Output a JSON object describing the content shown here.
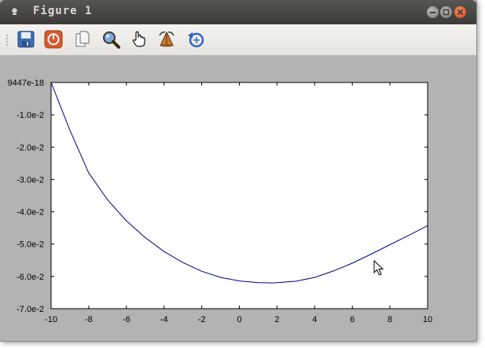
{
  "window": {
    "title": "Figure 1"
  },
  "toolbar": {
    "tools": [
      {
        "name": "save-icon"
      },
      {
        "name": "power-icon"
      },
      {
        "name": "copy-icon"
      },
      {
        "name": "zoom-icon"
      },
      {
        "name": "pan-hand-icon"
      },
      {
        "name": "rotate-3d-icon"
      },
      {
        "name": "reset-view-icon"
      }
    ]
  },
  "colors": {
    "titlebar": "#3c3b37",
    "background": "#b3b3b3",
    "plot_bg": "#ffffff",
    "line": "#00007f",
    "close_button": "#e0562a"
  },
  "chart_data": {
    "type": "line",
    "title": "",
    "xlabel": "",
    "ylabel": "",
    "xlim": [
      -10,
      10
    ],
    "ylim": [
      -0.07,
      0
    ],
    "grid": false,
    "x_ticks": [
      -10,
      -8,
      -6,
      -4,
      -2,
      0,
      2,
      4,
      6,
      8,
      10
    ],
    "x_tick_labels": [
      "-10",
      "-8",
      "-6",
      "-4",
      "-2",
      "0",
      "2",
      "4",
      "6",
      "8",
      "10"
    ],
    "y_ticks": [
      0,
      -0.01,
      -0.02,
      -0.03,
      -0.04,
      -0.05,
      -0.06,
      -0.07
    ],
    "y_tick_labels": [
      "9447e-18",
      "-1.0e-2",
      "-2.0e-2",
      "-3.0e-2",
      "-4.0e-2",
      "-5.0e-2",
      "-6.0e-2",
      "-7.0e-2"
    ],
    "series": [
      {
        "color": "#00007f",
        "x": [
          -10,
          -9,
          -8,
          -7,
          -6,
          -5,
          -4,
          -3,
          -2,
          -1,
          0,
          1,
          1.8,
          3,
          4,
          5,
          6,
          7,
          8,
          9,
          10
        ],
        "y": [
          0,
          -0.0148,
          -0.028,
          -0.0363,
          -0.0428,
          -0.048,
          -0.0523,
          -0.0557,
          -0.0584,
          -0.0603,
          -0.0614,
          -0.0619,
          -0.062,
          -0.0615,
          -0.0603,
          -0.0583,
          -0.0559,
          -0.0531,
          -0.0502,
          -0.0473,
          -0.0443
        ]
      }
    ]
  }
}
